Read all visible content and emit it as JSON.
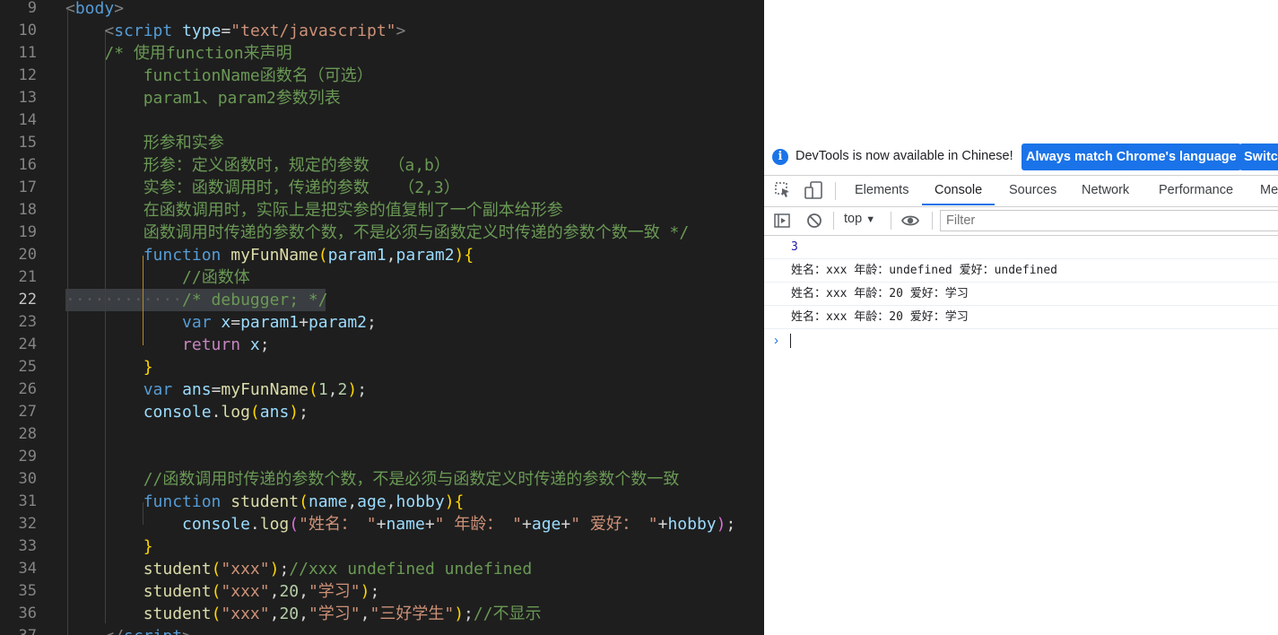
{
  "editor": {
    "lines": [
      {
        "n": "9",
        "segs": [
          [
            "c-tag",
            "<"
          ],
          [
            "c-tn",
            "body"
          ],
          [
            "c-tag",
            ">"
          ]
        ]
      },
      {
        "n": "10",
        "segs": [
          [
            "c-pl",
            "    "
          ],
          [
            "c-tag",
            "<"
          ],
          [
            "c-tn",
            "script"
          ],
          [
            "c-pl",
            " "
          ],
          [
            "c-attr",
            "type"
          ],
          [
            "c-pl",
            "="
          ],
          [
            "c-str",
            "\"text/javascript\""
          ],
          [
            "c-tag",
            ">"
          ]
        ]
      },
      {
        "n": "11",
        "segs": [
          [
            "c-pl",
            "    "
          ],
          [
            "c-cm",
            "/* 使用function来声明"
          ]
        ]
      },
      {
        "n": "12",
        "segs": [
          [
            "c-cm",
            "        functionName函数名（可选）"
          ]
        ]
      },
      {
        "n": "13",
        "segs": [
          [
            "c-cm",
            "        param1、param2参数列表"
          ]
        ]
      },
      {
        "n": "14",
        "segs": []
      },
      {
        "n": "15",
        "segs": [
          [
            "c-cm",
            "        形参和实参"
          ]
        ]
      },
      {
        "n": "16",
        "segs": [
          [
            "c-cm",
            "        形参：定义函数时，规定的参数  （a,b）"
          ]
        ]
      },
      {
        "n": "17",
        "segs": [
          [
            "c-cm",
            "        实参：函数调用时，传递的参数   （2,3）"
          ]
        ]
      },
      {
        "n": "18",
        "segs": [
          [
            "c-cm",
            "        在函数调用时，实际上是把实参的值复制了一个副本给形参"
          ]
        ]
      },
      {
        "n": "19",
        "segs": [
          [
            "c-cm",
            "        函数调用时传递的参数个数，不是必须与函数定义时传递的参数个数一致 */"
          ]
        ]
      },
      {
        "n": "20",
        "segs": [
          [
            "c-pl",
            "        "
          ],
          [
            "c-kw",
            "function"
          ],
          [
            "c-pl",
            " "
          ],
          [
            "c-fn",
            "myFunName"
          ],
          [
            "c-b1",
            "("
          ],
          [
            "c-var",
            "param1"
          ],
          [
            "c-pl",
            ","
          ],
          [
            "c-var",
            "param2"
          ],
          [
            "c-b1",
            ")"
          ],
          [
            "c-b1",
            "{"
          ]
        ]
      },
      {
        "n": "21",
        "segs": [
          [
            "c-pl",
            "            "
          ],
          [
            "c-cm",
            "//函数体"
          ]
        ]
      },
      {
        "n": "22",
        "segs": [
          [
            "c-cm",
            "            /* debugger; */"
          ]
        ],
        "active": true
      },
      {
        "n": "23",
        "segs": [
          [
            "c-pl",
            "            "
          ],
          [
            "c-kw",
            "var"
          ],
          [
            "c-pl",
            " "
          ],
          [
            "c-var",
            "x"
          ],
          [
            "c-pl",
            "="
          ],
          [
            "c-var",
            "param1"
          ],
          [
            "c-pl",
            "+"
          ],
          [
            "c-var",
            "param2"
          ],
          [
            "c-pl",
            ";"
          ]
        ]
      },
      {
        "n": "24",
        "segs": [
          [
            "c-pl",
            "            "
          ],
          [
            "c-ctl",
            "return"
          ],
          [
            "c-pl",
            " "
          ],
          [
            "c-var",
            "x"
          ],
          [
            "c-pl",
            ";"
          ]
        ]
      },
      {
        "n": "25",
        "segs": [
          [
            "c-pl",
            "        "
          ],
          [
            "c-b1",
            "}"
          ]
        ]
      },
      {
        "n": "26",
        "segs": [
          [
            "c-pl",
            "        "
          ],
          [
            "c-kw",
            "var"
          ],
          [
            "c-pl",
            " "
          ],
          [
            "c-var",
            "ans"
          ],
          [
            "c-pl",
            "="
          ],
          [
            "c-fn",
            "myFunName"
          ],
          [
            "c-b1",
            "("
          ],
          [
            "c-num",
            "1"
          ],
          [
            "c-pl",
            ","
          ],
          [
            "c-num",
            "2"
          ],
          [
            "c-b1",
            ")"
          ],
          [
            "c-pl",
            ";"
          ]
        ]
      },
      {
        "n": "27",
        "segs": [
          [
            "c-pl",
            "        "
          ],
          [
            "c-var",
            "console"
          ],
          [
            "c-pl",
            "."
          ],
          [
            "c-fn",
            "log"
          ],
          [
            "c-b1",
            "("
          ],
          [
            "c-var",
            "ans"
          ],
          [
            "c-b1",
            ")"
          ],
          [
            "c-pl",
            ";"
          ]
        ]
      },
      {
        "n": "28",
        "segs": []
      },
      {
        "n": "29",
        "segs": []
      },
      {
        "n": "30",
        "segs": [
          [
            "c-pl",
            "        "
          ],
          [
            "c-cm",
            "//函数调用时传递的参数个数，不是必须与函数定义时传递的参数个数一致"
          ]
        ]
      },
      {
        "n": "31",
        "segs": [
          [
            "c-pl",
            "        "
          ],
          [
            "c-kw",
            "function"
          ],
          [
            "c-pl",
            " "
          ],
          [
            "c-fn",
            "student"
          ],
          [
            "c-b1",
            "("
          ],
          [
            "c-var",
            "name"
          ],
          [
            "c-pl",
            ","
          ],
          [
            "c-var",
            "age"
          ],
          [
            "c-pl",
            ","
          ],
          [
            "c-var",
            "hobby"
          ],
          [
            "c-b1",
            ")"
          ],
          [
            "c-b1",
            "{"
          ]
        ]
      },
      {
        "n": "32",
        "segs": [
          [
            "c-pl",
            "            "
          ],
          [
            "c-var",
            "console"
          ],
          [
            "c-pl",
            "."
          ],
          [
            "c-fn",
            "log"
          ],
          [
            "c-b2",
            "("
          ],
          [
            "c-str",
            "\"姓名： \""
          ],
          [
            "c-pl",
            "+"
          ],
          [
            "c-var",
            "name"
          ],
          [
            "c-pl",
            "+"
          ],
          [
            "c-str",
            "\" 年龄： \""
          ],
          [
            "c-pl",
            "+"
          ],
          [
            "c-var",
            "age"
          ],
          [
            "c-pl",
            "+"
          ],
          [
            "c-str",
            "\" 爱好： \""
          ],
          [
            "c-pl",
            "+"
          ],
          [
            "c-var",
            "hobby"
          ],
          [
            "c-b2",
            ")"
          ],
          [
            "c-pl",
            ";"
          ]
        ]
      },
      {
        "n": "33",
        "segs": [
          [
            "c-pl",
            "        "
          ],
          [
            "c-b1",
            "}"
          ]
        ]
      },
      {
        "n": "34",
        "segs": [
          [
            "c-pl",
            "        "
          ],
          [
            "c-fn",
            "student"
          ],
          [
            "c-b1",
            "("
          ],
          [
            "c-str",
            "\"xxx\""
          ],
          [
            "c-b1",
            ")"
          ],
          [
            "c-pl",
            ";"
          ],
          [
            "c-cm",
            "//xxx undefined undefined"
          ]
        ]
      },
      {
        "n": "35",
        "segs": [
          [
            "c-pl",
            "        "
          ],
          [
            "c-fn",
            "student"
          ],
          [
            "c-b1",
            "("
          ],
          [
            "c-str",
            "\"xxx\""
          ],
          [
            "c-pl",
            ","
          ],
          [
            "c-num",
            "20"
          ],
          [
            "c-pl",
            ","
          ],
          [
            "c-str",
            "\"学习\""
          ],
          [
            "c-b1",
            ")"
          ],
          [
            "c-pl",
            ";"
          ]
        ]
      },
      {
        "n": "36",
        "segs": [
          [
            "c-pl",
            "        "
          ],
          [
            "c-fn",
            "student"
          ],
          [
            "c-b1",
            "("
          ],
          [
            "c-str",
            "\"xxx\""
          ],
          [
            "c-pl",
            ","
          ],
          [
            "c-num",
            "20"
          ],
          [
            "c-pl",
            ","
          ],
          [
            "c-str",
            "\"学习\""
          ],
          [
            "c-pl",
            ","
          ],
          [
            "c-str",
            "\"三好学生\""
          ],
          [
            "c-b1",
            ")"
          ],
          [
            "c-pl",
            ";"
          ],
          [
            "c-cm",
            "//不显示"
          ]
        ]
      },
      {
        "n": "37",
        "segs": [
          [
            "c-pl",
            "    "
          ],
          [
            "c-tag",
            "</"
          ],
          [
            "c-tn",
            "script"
          ],
          [
            "c-tag",
            ">"
          ]
        ]
      }
    ]
  },
  "devtools": {
    "info": {
      "icon": "info-icon",
      "text": "DevTools is now available in Chinese!",
      "btn_match": "Always match Chrome's language",
      "btn_switch": "Switch"
    },
    "tabs": {
      "elements": "Elements",
      "console": "Console",
      "sources": "Sources",
      "network": "Network",
      "performance": "Performance",
      "more": "Me"
    },
    "toolbar": {
      "context": "top",
      "filter_placeholder": "Filter"
    },
    "console": {
      "messages": [
        {
          "text": "3",
          "kind": "num"
        },
        {
          "text": "姓名：xxx 年龄：undefined 爱好：undefined",
          "kind": "str"
        },
        {
          "text": "姓名：xxx 年龄：20 爱好：学习",
          "kind": "str"
        },
        {
          "text": "姓名：xxx 年龄：20 爱好：学习",
          "kind": "str"
        }
      ],
      "prompt_symbol": "›"
    }
  }
}
